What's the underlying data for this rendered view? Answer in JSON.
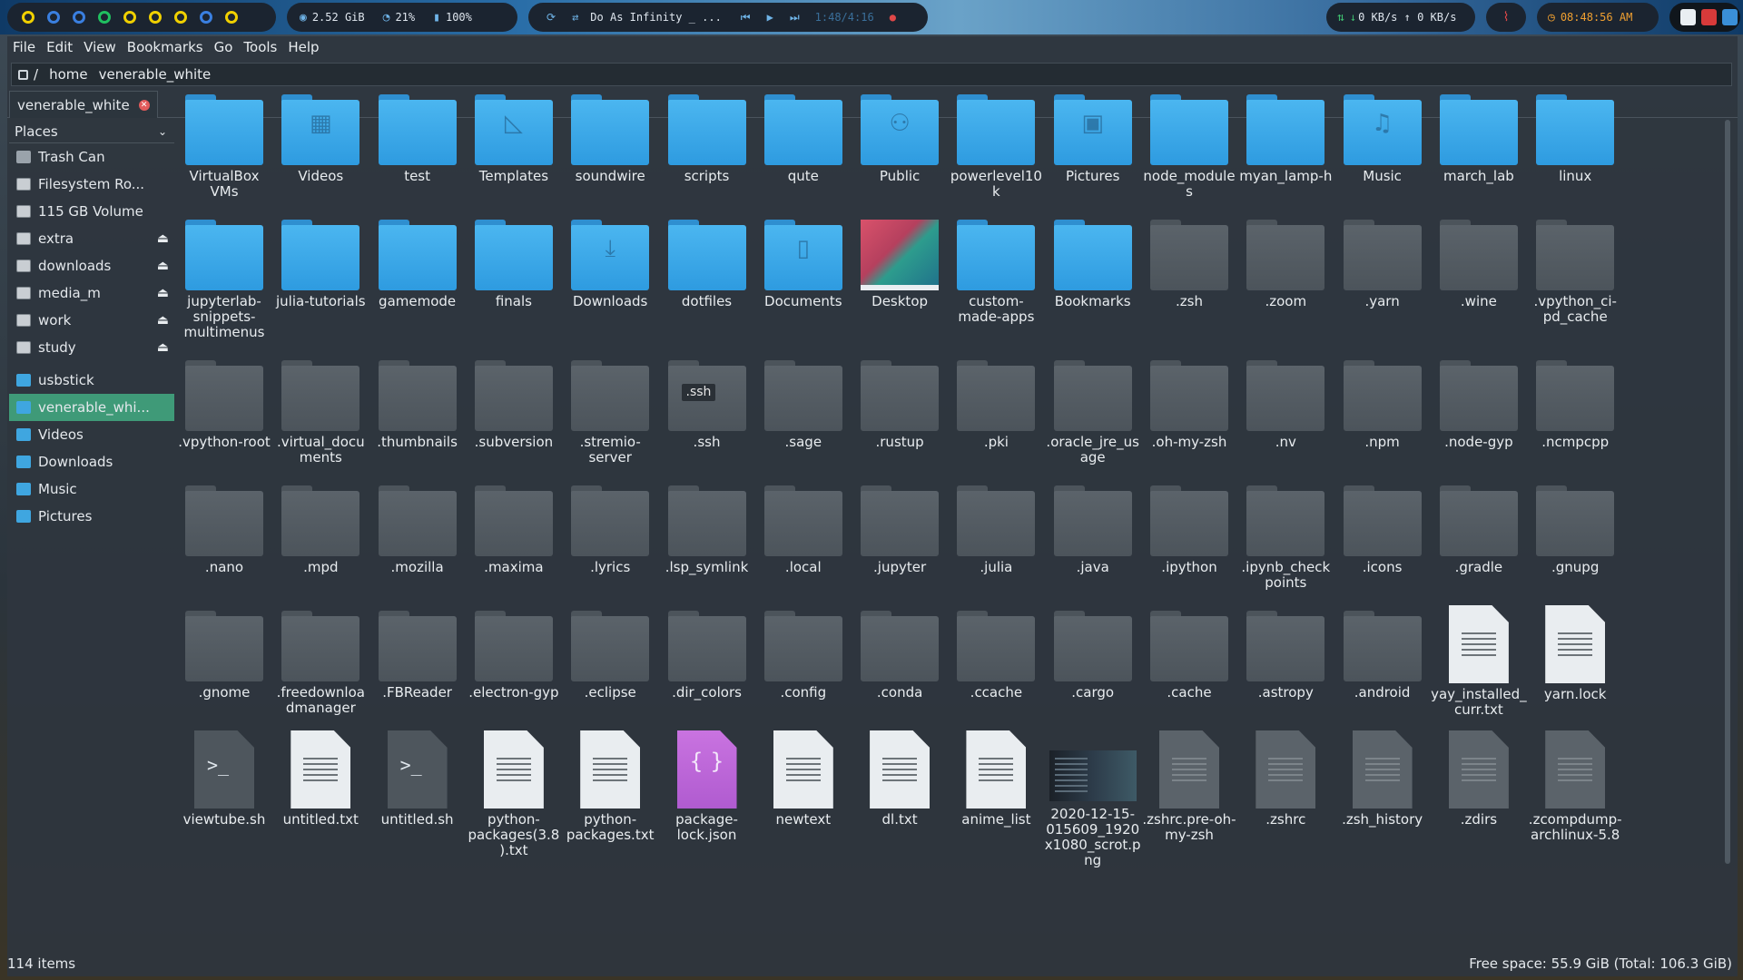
{
  "panel": {
    "workspace_colors": [
      "#f0d000",
      "#3a7fe0",
      "#3a7fe0",
      "#20c060",
      "#f0d000",
      "#f0d000",
      "#f0d000",
      "#3a7fe0",
      "#f0d000"
    ],
    "memory": "2.52 GiB",
    "cpu": "21%",
    "battery": "100%",
    "now_playing": "Do As Infinity _ ...",
    "track_time": "1:48/4:16",
    "net": "0 KB/s ↑ 0 KB/s",
    "clock": "08:48:56 AM"
  },
  "menubar": [
    "File",
    "Edit",
    "View",
    "Bookmarks",
    "Go",
    "Tools",
    "Help"
  ],
  "location": {
    "root": "/",
    "segments": [
      "home",
      "venerable_white"
    ]
  },
  "tab": {
    "label": "venerable_white"
  },
  "sidebar": {
    "header": "Places",
    "items": [
      {
        "label": "Trash Can",
        "icon": "trash-icon",
        "eject": false
      },
      {
        "label": "Filesystem Ro...",
        "icon": "drive-icon",
        "eject": false
      },
      {
        "label": "115 GB Volume",
        "icon": "drive-icon",
        "eject": false
      },
      {
        "label": "extra",
        "icon": "drive-icon",
        "eject": true
      },
      {
        "label": "downloads",
        "icon": "drive-icon",
        "eject": true
      },
      {
        "label": "media_m",
        "icon": "drive-icon",
        "eject": true
      },
      {
        "label": "work",
        "icon": "drive-icon",
        "eject": true
      },
      {
        "label": "study",
        "icon": "drive-icon",
        "eject": true
      }
    ],
    "bookmarks": [
      {
        "label": "usbstick",
        "active": false
      },
      {
        "label": "venerable_whi...",
        "active": true
      },
      {
        "label": "Videos",
        "active": false
      },
      {
        "label": "Downloads",
        "active": false
      },
      {
        "label": "Music",
        "active": false
      },
      {
        "label": "Pictures",
        "active": false
      }
    ]
  },
  "files": [
    {
      "name": "VirtualBox VMs",
      "kind": "folder"
    },
    {
      "name": "Videos",
      "kind": "folder",
      "emblem": "▦"
    },
    {
      "name": "test",
      "kind": "folder"
    },
    {
      "name": "Templates",
      "kind": "folder",
      "emblem": "◺"
    },
    {
      "name": "soundwire",
      "kind": "folder"
    },
    {
      "name": "scripts",
      "kind": "folder"
    },
    {
      "name": "qute",
      "kind": "folder"
    },
    {
      "name": "Public",
      "kind": "folder",
      "emblem": "⚇"
    },
    {
      "name": "powerlevel10k",
      "kind": "folder"
    },
    {
      "name": "Pictures",
      "kind": "folder",
      "emblem": "▣"
    },
    {
      "name": "node_modules",
      "kind": "folder"
    },
    {
      "name": "myan_lamp-h",
      "kind": "folder"
    },
    {
      "name": "Music",
      "kind": "folder",
      "emblem": "♫"
    },
    {
      "name": "march_lab",
      "kind": "folder"
    },
    {
      "name": "linux",
      "kind": "folder"
    },
    {
      "name": "jupyterlab-snippets-multimenus",
      "kind": "folder"
    },
    {
      "name": "julia-tutorials",
      "kind": "folder"
    },
    {
      "name": "gamemode",
      "kind": "folder"
    },
    {
      "name": "finals",
      "kind": "folder"
    },
    {
      "name": "Downloads",
      "kind": "folder",
      "emblem": "⤓"
    },
    {
      "name": "dotfiles",
      "kind": "folder"
    },
    {
      "name": "Documents",
      "kind": "folder",
      "emblem": "▯"
    },
    {
      "name": "Desktop",
      "kind": "desktop"
    },
    {
      "name": "custom-made-apps",
      "kind": "folder"
    },
    {
      "name": "Bookmarks",
      "kind": "folder"
    },
    {
      "name": ".zsh",
      "kind": "hidden"
    },
    {
      "name": ".zoom",
      "kind": "hidden"
    },
    {
      "name": ".yarn",
      "kind": "hidden"
    },
    {
      "name": ".wine",
      "kind": "hidden"
    },
    {
      "name": ".vpython_ci-pd_cache",
      "kind": "hidden"
    },
    {
      "name": ".vpython-root",
      "kind": "hidden"
    },
    {
      "name": ".virtual_documents",
      "kind": "hidden"
    },
    {
      "name": ".thumbnails",
      "kind": "hidden"
    },
    {
      "name": ".subversion",
      "kind": "hidden"
    },
    {
      "name": ".stremio-server",
      "kind": "hidden"
    },
    {
      "name": ".ssh",
      "kind": "hidden",
      "tag": ".ssh"
    },
    {
      "name": ".sage",
      "kind": "hidden"
    },
    {
      "name": ".rustup",
      "kind": "hidden"
    },
    {
      "name": ".pki",
      "kind": "hidden"
    },
    {
      "name": ".oracle_jre_usage",
      "kind": "hidden"
    },
    {
      "name": ".oh-my-zsh",
      "kind": "hidden"
    },
    {
      "name": ".nv",
      "kind": "hidden"
    },
    {
      "name": ".npm",
      "kind": "hidden"
    },
    {
      "name": ".node-gyp",
      "kind": "hidden"
    },
    {
      "name": ".ncmpcpp",
      "kind": "hidden"
    },
    {
      "name": ".nano",
      "kind": "hidden"
    },
    {
      "name": ".mpd",
      "kind": "hidden"
    },
    {
      "name": ".mozilla",
      "kind": "hidden"
    },
    {
      "name": ".maxima",
      "kind": "hidden"
    },
    {
      "name": ".lyrics",
      "kind": "hidden"
    },
    {
      "name": ".lsp_symlink",
      "kind": "hidden"
    },
    {
      "name": ".local",
      "kind": "hidden"
    },
    {
      "name": ".jupyter",
      "kind": "hidden"
    },
    {
      "name": ".julia",
      "kind": "hidden"
    },
    {
      "name": ".java",
      "kind": "hidden"
    },
    {
      "name": ".ipython",
      "kind": "hidden"
    },
    {
      "name": ".ipynb_checkpoints",
      "kind": "hidden"
    },
    {
      "name": ".icons",
      "kind": "hidden"
    },
    {
      "name": ".gradle",
      "kind": "hidden"
    },
    {
      "name": ".gnupg",
      "kind": "hidden"
    },
    {
      "name": ".gnome",
      "kind": "hidden"
    },
    {
      "name": ".freedownloadmanager",
      "kind": "hidden"
    },
    {
      "name": ".FBReader",
      "kind": "hidden"
    },
    {
      "name": ".electron-gyp",
      "kind": "hidden"
    },
    {
      "name": ".eclipse",
      "kind": "hidden"
    },
    {
      "name": ".dir_colors",
      "kind": "hidden"
    },
    {
      "name": ".config",
      "kind": "hidden"
    },
    {
      "name": ".conda",
      "kind": "hidden"
    },
    {
      "name": ".ccache",
      "kind": "hidden"
    },
    {
      "name": ".cargo",
      "kind": "hidden"
    },
    {
      "name": ".cache",
      "kind": "hidden"
    },
    {
      "name": ".astropy",
      "kind": "hidden"
    },
    {
      "name": ".android",
      "kind": "hidden"
    },
    {
      "name": "yay_installed_curr.txt",
      "kind": "text"
    },
    {
      "name": "yarn.lock",
      "kind": "text"
    },
    {
      "name": "viewtube.sh",
      "kind": "script"
    },
    {
      "name": "untitled.txt",
      "kind": "text"
    },
    {
      "name": "untitled.sh",
      "kind": "script"
    },
    {
      "name": "python-packages(3.8).txt",
      "kind": "text"
    },
    {
      "name": "python-packages.txt",
      "kind": "text"
    },
    {
      "name": "package-lock.json",
      "kind": "json"
    },
    {
      "name": "newtext",
      "kind": "text"
    },
    {
      "name": "dl.txt",
      "kind": "text"
    },
    {
      "name": "anime_list",
      "kind": "text"
    },
    {
      "name": "2020-12-15-015609_1920x1080_scrot.png",
      "kind": "image"
    },
    {
      "name": ".zshrc.pre-oh-my-zsh",
      "kind": "dimtext"
    },
    {
      "name": ".zshrc",
      "kind": "dimtext"
    },
    {
      "name": ".zsh_history",
      "kind": "dimtext"
    },
    {
      "name": ".zdirs",
      "kind": "dimtext"
    },
    {
      "name": ".zcompdump-archlinux-5.8",
      "kind": "dimtext"
    }
  ],
  "status": {
    "count": "114 items",
    "free": "Free space: 55.9 GiB (Total: 106.3 GiB)"
  }
}
